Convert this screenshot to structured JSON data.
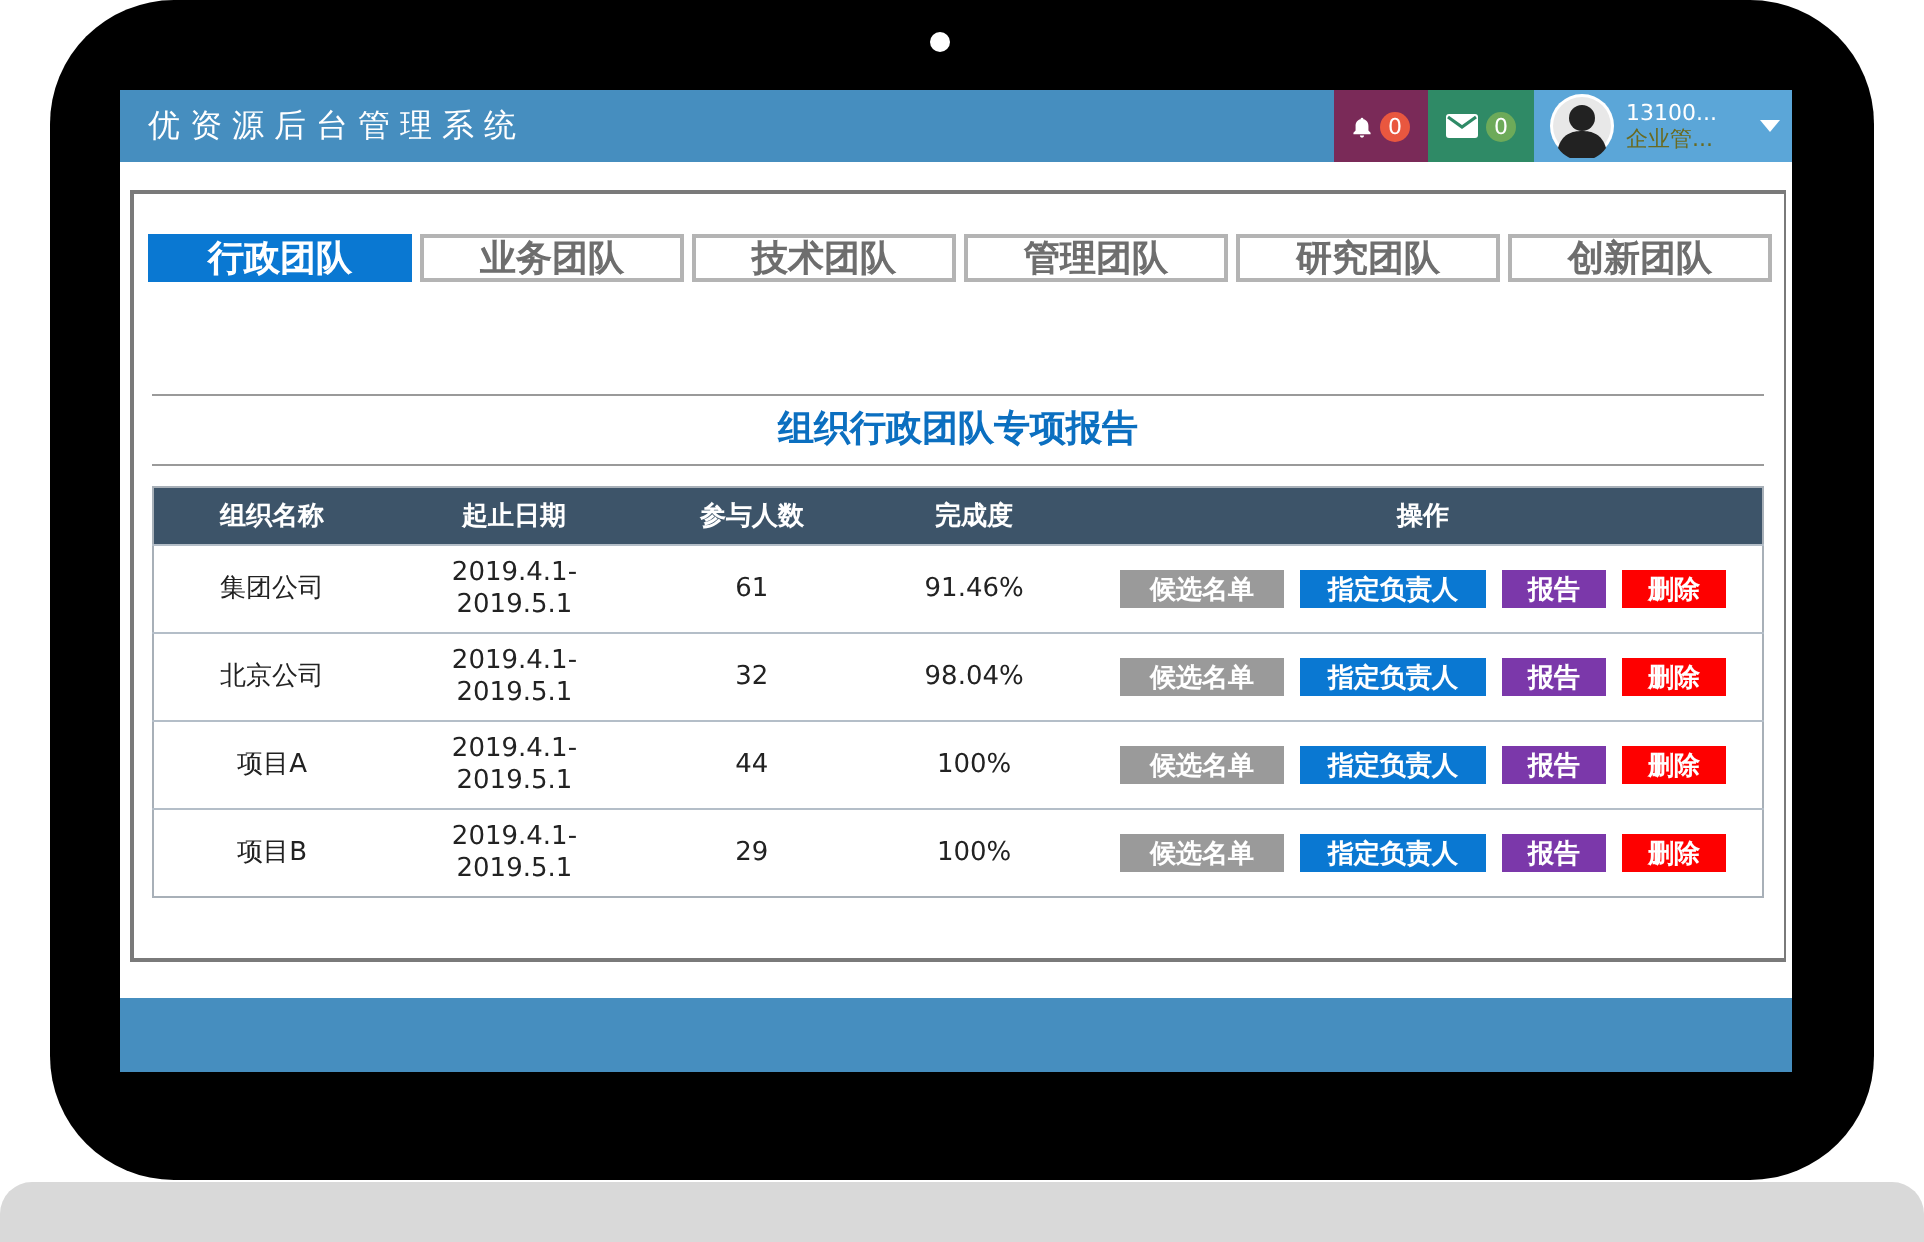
{
  "header": {
    "title": "优资源后台管理系统",
    "notifications": {
      "count": "0"
    },
    "messages": {
      "count": "0"
    },
    "user": {
      "name": "13100...",
      "role": "企业管..."
    }
  },
  "tabs": [
    {
      "label": "行政团队",
      "selected": true
    },
    {
      "label": "业务团队",
      "selected": false
    },
    {
      "label": "技术团队",
      "selected": false
    },
    {
      "label": "管理团队",
      "selected": false
    },
    {
      "label": "研究团队",
      "selected": false
    },
    {
      "label": "创新团队",
      "selected": false
    }
  ],
  "report": {
    "title": "组织行政团队专项报告",
    "columns": [
      "组织名称",
      "起止日期",
      "参与人数",
      "完成度",
      "操作"
    ],
    "rows": [
      {
        "name": "集团公司",
        "dates": [
          "2019.4.1-",
          "2019.5.1"
        ],
        "count": "61",
        "completion": "91.46%",
        "actions": [
          {
            "kind": "candidates",
            "label": "候选名单"
          },
          {
            "kind": "assign",
            "label": "指定负责人"
          },
          {
            "kind": "report",
            "label": "报告"
          },
          {
            "kind": "delete",
            "label": "删除"
          }
        ]
      },
      {
        "name": "北京公司",
        "dates": [
          "2019.4.1-",
          "2019.5.1"
        ],
        "count": "32",
        "completion": "98.04%",
        "actions": [
          {
            "kind": "candidates",
            "label": "候选名单"
          },
          {
            "kind": "assign",
            "label": "指定负责人"
          },
          {
            "kind": "report",
            "label": "报告"
          },
          {
            "kind": "delete",
            "label": "删除"
          }
        ]
      },
      {
        "name": "项目A",
        "dates": [
          "2019.4.1-",
          "2019.5.1"
        ],
        "count": "44",
        "completion": "100%",
        "actions": [
          {
            "kind": "candidates",
            "label": "候选名单"
          },
          {
            "kind": "assign",
            "label": "指定负责人"
          },
          {
            "kind": "report",
            "label": "报告"
          },
          {
            "kind": "delete",
            "label": "删除"
          }
        ]
      },
      {
        "name": "项目B",
        "dates": [
          "2019.4.1-",
          "2019.5.1"
        ],
        "count": "29",
        "completion": "100%",
        "actions": [
          {
            "kind": "candidates",
            "label": "候选名单"
          },
          {
            "kind": "assign",
            "label": "指定负责人"
          },
          {
            "kind": "report",
            "label": "报告"
          },
          {
            "kind": "delete",
            "label": "删除"
          }
        ]
      }
    ]
  }
}
